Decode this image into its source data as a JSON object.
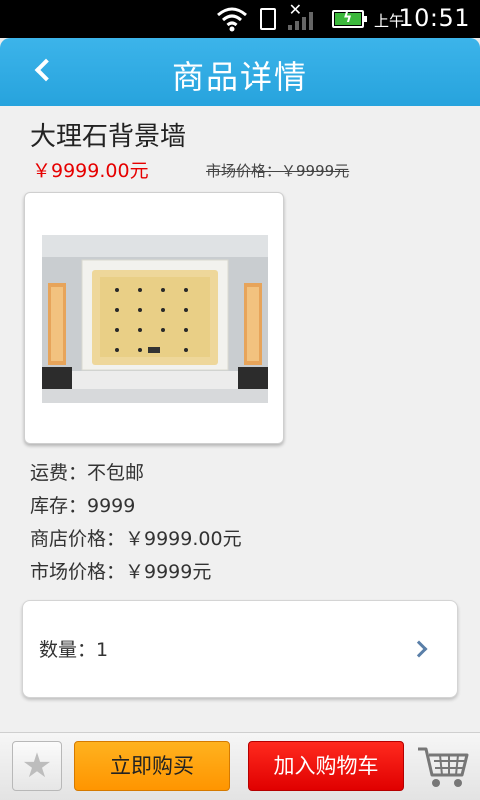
{
  "status_bar": {
    "time": "10:51",
    "ampm": "上午"
  },
  "header": {
    "title": "商品详情"
  },
  "product": {
    "name": "大理石背景墙",
    "price": "￥9999.00元",
    "market_price_top": "市场价格：￥9999元"
  },
  "info": {
    "shipping": "运费：不包邮",
    "stock": "库存：9999",
    "shop_price": "商店价格：￥9999.00元",
    "market_price": "市场价格：￥9999元"
  },
  "quantity": {
    "label": "数量：1"
  },
  "bottom_bar": {
    "buy_now_label": "立即购买",
    "add_cart_label": "加入购物车"
  },
  "colors": {
    "accent": "#27a3dd",
    "price": "#e60000",
    "buy_now": "#ff9500",
    "add_cart": "#e00000"
  },
  "icons": {
    "back": "back-chevron-icon",
    "favorite": "star-icon",
    "cart": "shopping-cart-icon",
    "quantity_arrow": "chevron-right-icon"
  }
}
